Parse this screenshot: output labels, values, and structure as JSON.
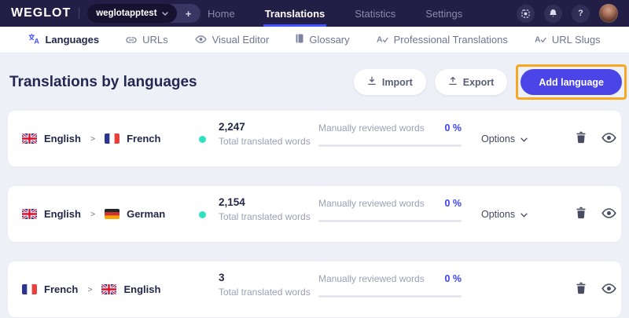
{
  "header": {
    "logo": "WEGLOT",
    "project_name": "weglotapptest",
    "add_project_label": "+",
    "help_label": "?",
    "nav": [
      {
        "label": "Home",
        "active": false
      },
      {
        "label": "Translations",
        "active": true
      },
      {
        "label": "Statistics",
        "active": false
      },
      {
        "label": "Settings",
        "active": false
      }
    ]
  },
  "subnav": {
    "tabs": [
      {
        "label": "Languages",
        "icon": "translate-icon",
        "active": true
      },
      {
        "label": "URLs",
        "icon": "link-icon",
        "active": false
      },
      {
        "label": "Visual Editor",
        "icon": "eye-icon",
        "active": false
      },
      {
        "label": "Glossary",
        "icon": "book-icon",
        "active": false
      },
      {
        "label": "Professional Translations",
        "icon": "pro-translate-icon",
        "active": false
      },
      {
        "label": "URL Slugs",
        "icon": "slug-icon",
        "active": false
      }
    ]
  },
  "main": {
    "title": "Translations by languages",
    "toolbar": {
      "import_label": "Import",
      "export_label": "Export",
      "add_language_label": "Add language"
    },
    "rows": [
      {
        "source": "English",
        "source_flag": "uk",
        "target": "French",
        "target_flag": "fr",
        "separator": ">",
        "status_dot": true,
        "total_words": "2,247",
        "total_words_label": "Total translated words",
        "reviewed_label": "Manually reviewed words",
        "reviewed_percent": "0 %",
        "reviewed_progress": 0,
        "options_label": "Options"
      },
      {
        "source": "English",
        "source_flag": "uk",
        "target": "German",
        "target_flag": "de",
        "separator": ">",
        "status_dot": true,
        "total_words": "2,154",
        "total_words_label": "Total translated words",
        "reviewed_label": "Manually reviewed words",
        "reviewed_percent": "0 %",
        "reviewed_progress": 0,
        "options_label": "Options"
      },
      {
        "source": "French",
        "source_flag": "fr",
        "target": "English",
        "target_flag": "uk",
        "separator": ">",
        "status_dot": false,
        "total_words": "3",
        "total_words_label": "Total translated words",
        "reviewed_label": "Manually reviewed words",
        "reviewed_percent": "0 %",
        "reviewed_progress": 0
      }
    ]
  },
  "colors": {
    "header_bg": "#221e46",
    "accent_blue": "#4353ff",
    "button_blue": "#4b45e8",
    "percent_blue": "#3b3ff2",
    "status_teal": "#2ee0bd",
    "highlight_orange": "#f6a822",
    "page_bg": "#eef0f7",
    "card_bg": "#ffffff"
  }
}
